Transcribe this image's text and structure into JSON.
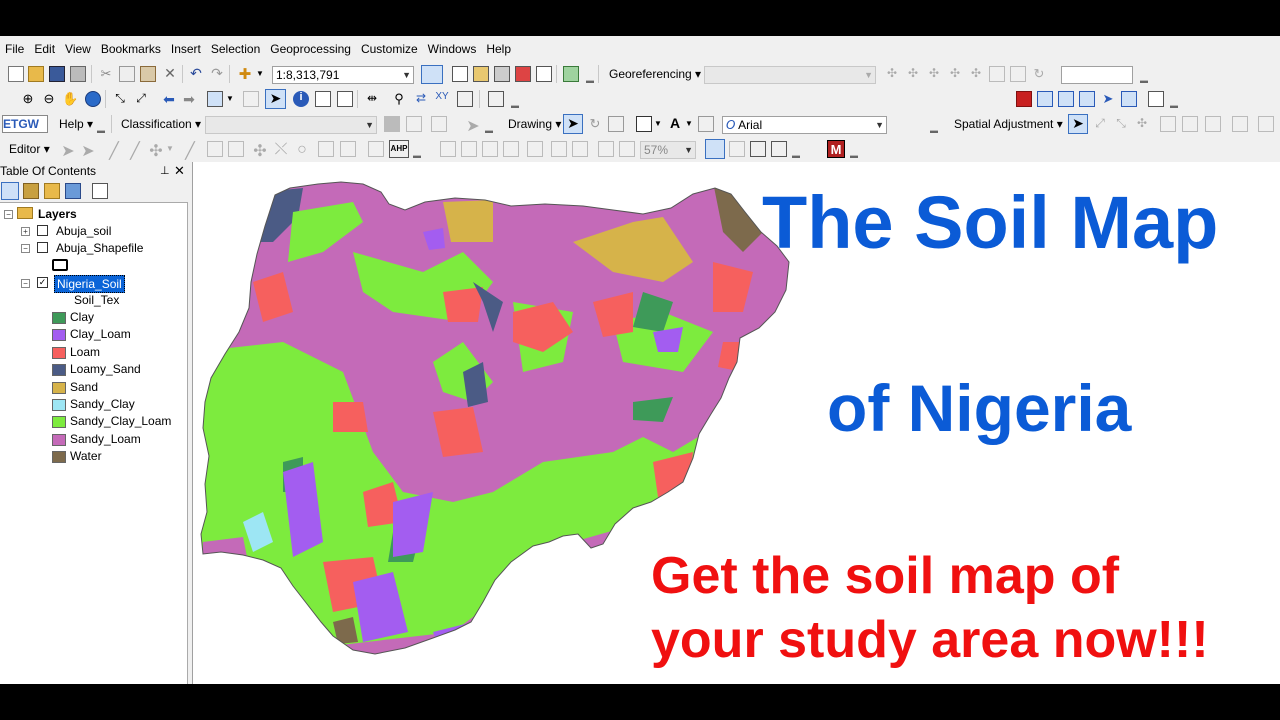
{
  "menu": [
    "File",
    "Edit",
    "View",
    "Bookmarks",
    "Insert",
    "Selection",
    "Geoprocessing",
    "Customize",
    "Windows",
    "Help"
  ],
  "toolbar": {
    "scale_value": "1:8,313,791",
    "georeferencing_label": "Georeferencing",
    "help_label": "Help",
    "classification_label": "Classification",
    "drawing_label": "Drawing",
    "font_value": "Arial",
    "spatial_adjustment_label": "Spatial Adjustment",
    "editor_label": "Editor",
    "zoom_value": "57%",
    "etgw_label": "ETGW",
    "m_label": "M"
  },
  "toc": {
    "title": "Table Of Contents",
    "root": "Layers",
    "layers": [
      {
        "name": "Abuja_soil",
        "checked": false
      },
      {
        "name": "Abuja_Shapefile",
        "checked": false
      },
      {
        "name": "Nigeria_Soil",
        "checked": true
      }
    ],
    "field": "Soil_Tex",
    "legend": [
      {
        "label": "Clay",
        "color": "#3e9a59"
      },
      {
        "label": "Clay_Loam",
        "color": "#a35df0"
      },
      {
        "label": "Loam",
        "color": "#f6605e"
      },
      {
        "label": "Loamy_Sand",
        "color": "#4b5b85"
      },
      {
        "label": "Sand",
        "color": "#d6b34a"
      },
      {
        "label": "Sandy_Clay",
        "color": "#9de6f4"
      },
      {
        "label": "Sandy_Clay_Loam",
        "color": "#7deb3e"
      },
      {
        "label": "Sandy_Loam",
        "color": "#c46ab8"
      },
      {
        "label": "Water",
        "color": "#7d6a4c"
      }
    ]
  },
  "overlay": {
    "title_line1": "The Soil Map",
    "title_line2": "of Nigeria",
    "cta_line1": "Get the soil map of",
    "cta_line2": "your study area now!!!",
    "title_color": "#0b5bd6",
    "cta_color": "#f01010"
  }
}
